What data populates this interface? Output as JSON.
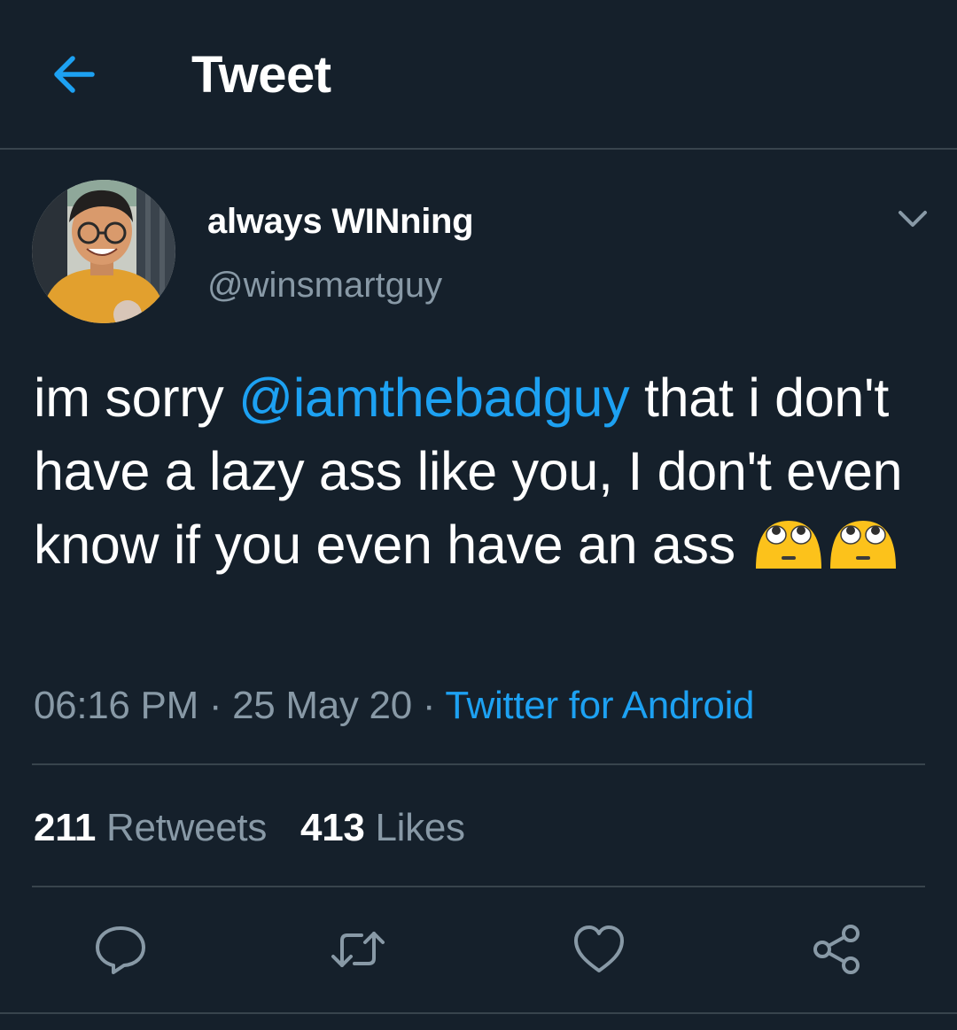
{
  "header": {
    "title": "Tweet",
    "back_icon": "arrow-left-icon"
  },
  "author": {
    "display_name": "always WINning",
    "handle": "@winsmartguy",
    "menu_icon": "chevron-down-icon"
  },
  "tweet": {
    "text_before": "im sorry ",
    "mention": "@iamthebadguy",
    "text_after": " that i don't have a lazy ass like you, I don't even know if you even have an ass ",
    "emojis": [
      "face-with-rolling-eyes-emoji",
      "face-with-rolling-eyes-emoji"
    ]
  },
  "meta": {
    "time": "06:16 PM",
    "sep1": " · ",
    "date": "25 May 20",
    "sep2": " · ",
    "source": "Twitter for Android"
  },
  "stats": {
    "retweets_count": "211",
    "retweets_label": "Retweets",
    "likes_count": "413",
    "likes_label": "Likes"
  },
  "actions": {
    "reply_icon": "reply-icon",
    "retweet_icon": "retweet-icon",
    "like_icon": "heart-icon",
    "share_icon": "share-icon"
  },
  "colors": {
    "background": "#15202b",
    "accent": "#1da1f2",
    "secondary_text": "#8899a6",
    "divider": "#38444d",
    "emoji_yellow": "#fcc21b"
  }
}
